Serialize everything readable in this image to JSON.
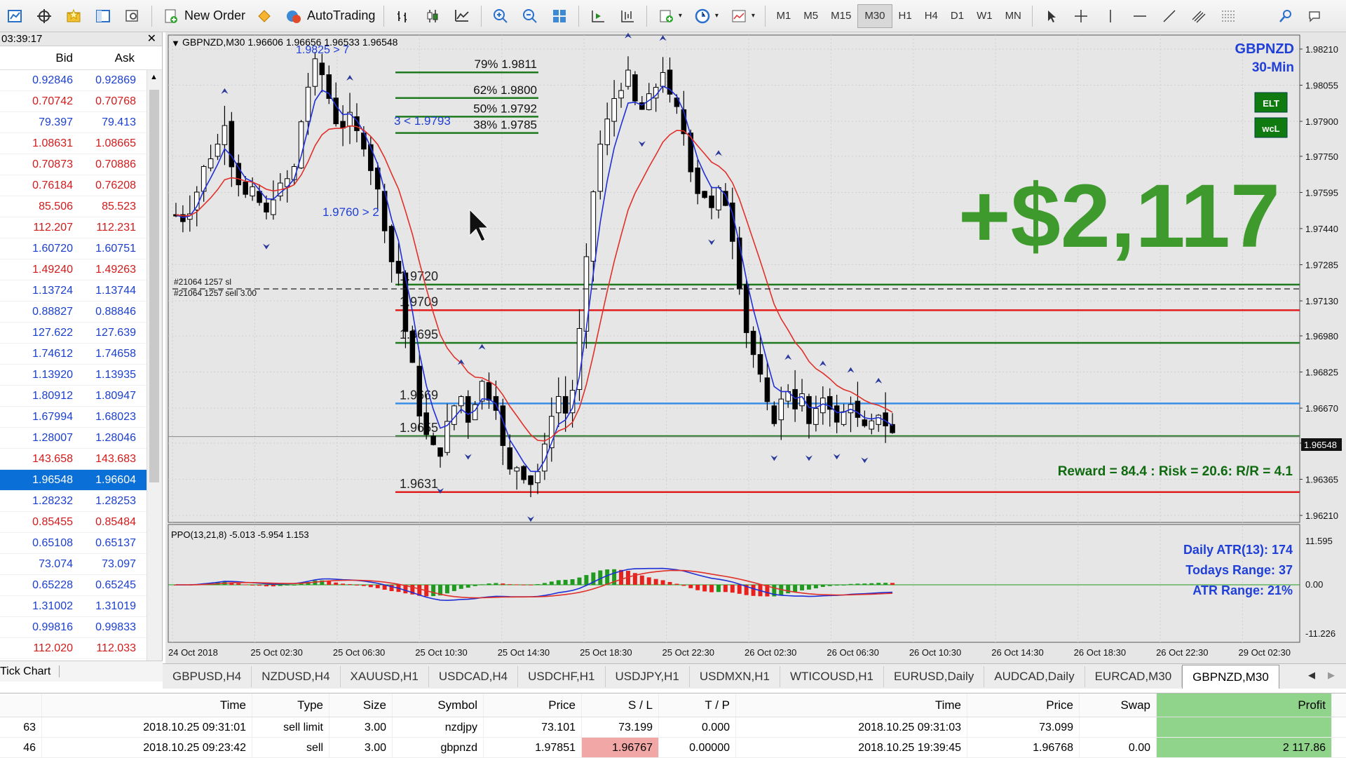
{
  "toolbar": {
    "new_order_label": "New Order",
    "autotrading_label": "AutoTrading",
    "timeframes": [
      "M1",
      "M5",
      "M15",
      "M30",
      "H1",
      "H4",
      "D1",
      "W1",
      "MN"
    ],
    "active_timeframe": "M30"
  },
  "market_watch": {
    "time": "03:39:17",
    "col_bid": "Bid",
    "col_ask": "Ask",
    "rows": [
      {
        "bid": "0.92846",
        "ask": "0.92869",
        "color": "blue"
      },
      {
        "bid": "0.70742",
        "ask": "0.70768",
        "color": "red"
      },
      {
        "bid": "79.397",
        "ask": "79.413",
        "color": "blue"
      },
      {
        "bid": "1.08631",
        "ask": "1.08665",
        "color": "red"
      },
      {
        "bid": "0.70873",
        "ask": "0.70886",
        "color": "red"
      },
      {
        "bid": "0.76184",
        "ask": "0.76208",
        "color": "red"
      },
      {
        "bid": "85.506",
        "ask": "85.523",
        "color": "red"
      },
      {
        "bid": "112.207",
        "ask": "112.231",
        "color": "red"
      },
      {
        "bid": "1.60720",
        "ask": "1.60751",
        "color": "blue"
      },
      {
        "bid": "1.49240",
        "ask": "1.49263",
        "color": "red"
      },
      {
        "bid": "1.13724",
        "ask": "1.13744",
        "color": "blue"
      },
      {
        "bid": "0.88827",
        "ask": "0.88846",
        "color": "blue"
      },
      {
        "bid": "127.622",
        "ask": "127.639",
        "color": "blue"
      },
      {
        "bid": "1.74612",
        "ask": "1.74658",
        "color": "blue"
      },
      {
        "bid": "1.13920",
        "ask": "1.13935",
        "color": "blue"
      },
      {
        "bid": "1.80912",
        "ask": "1.80947",
        "color": "blue"
      },
      {
        "bid": "1.67994",
        "ask": "1.68023",
        "color": "blue"
      },
      {
        "bid": "1.28007",
        "ask": "1.28046",
        "color": "blue"
      },
      {
        "bid": "143.658",
        "ask": "143.683",
        "color": "red"
      },
      {
        "bid": "1.96548",
        "ask": "1.96604",
        "color": "selected"
      },
      {
        "bid": "1.28232",
        "ask": "1.28253",
        "color": "blue"
      },
      {
        "bid": "0.85455",
        "ask": "0.85484",
        "color": "red"
      },
      {
        "bid": "0.65108",
        "ask": "0.65137",
        "color": "blue"
      },
      {
        "bid": "73.074",
        "ask": "73.097",
        "color": "blue"
      },
      {
        "bid": "0.65228",
        "ask": "0.65245",
        "color": "blue"
      },
      {
        "bid": "1.31002",
        "ask": "1.31019",
        "color": "blue"
      },
      {
        "bid": "0.99816",
        "ask": "0.99833",
        "color": "blue"
      },
      {
        "bid": "112.020",
        "ask": "112.033",
        "color": "red"
      }
    ],
    "footer_tab": "Tick Chart"
  },
  "chart": {
    "header": "GBPNZD,M30  1.96606 1.96656 1.96533 1.96548",
    "symbol": "GBPNZD",
    "timeframe": "30-Min",
    "badge1": "ELT",
    "badge2": "wcL",
    "profit_overlay": "+$2,117",
    "reward_risk": "Reward = 84.4 : Risk = 20.6: R/R = 4.1",
    "current_price": "1.96548",
    "fib_labels": [
      "79% 1.9811",
      "62% 1.9800",
      "50% 1.9792",
      "38% 1.9785"
    ],
    "blue_labels": [
      "1.9825 > 7",
      "3 < 1.9793",
      "1.9760 > 2"
    ],
    "order_labels": [
      "#21064 1257 sl",
      "#21064 1257 sell 3.00"
    ],
    "hlines": [
      {
        "price": "1.9720",
        "color": "#1e7a1e"
      },
      {
        "price": "1.9709",
        "color": "#e01e1e"
      },
      {
        "price": "1.9695",
        "color": "#1e7a1e"
      },
      {
        "price": "1.9669",
        "color": "#3a8ee6"
      },
      {
        "price": "1.9655",
        "color": "#1e7a1e"
      },
      {
        "price": "1.9631",
        "color": "#e01e1e"
      }
    ],
    "price_axis": [
      "1.98210",
      "1.98055",
      "1.97900",
      "1.97750",
      "1.97595",
      "1.97440",
      "1.97285",
      "1.97130",
      "1.96980",
      "1.96825",
      "1.96670",
      "1.96520",
      "1.96365",
      "1.96210"
    ],
    "time_axis": [
      "24 Oct 2018",
      "25 Oct 02:30",
      "25 Oct 06:30",
      "25 Oct 10:30",
      "25 Oct 14:30",
      "25 Oct 18:30",
      "25 Oct 22:30",
      "26 Oct 02:30",
      "26 Oct 06:30",
      "26 Oct 10:30",
      "26 Oct 14:30",
      "26 Oct 18:30",
      "26 Oct 22:30",
      "29 Oct 02:30"
    ],
    "indicator": {
      "header": "PPO(13,21,8) -5.013 -5.954 1.153",
      "axis": [
        "11.595",
        "0.00",
        "-11.226"
      ],
      "atr_line1": "Daily ATR(13): 174",
      "atr_line2": "Todays Range: 37",
      "atr_line3": "ATR Range: 21%"
    }
  },
  "chart_tabs": [
    "GBPUSD,H4",
    "NZDUSD,H4",
    "XAUUSD,H1",
    "USDCAD,H4",
    "USDCHF,H1",
    "USDJPY,H1",
    "USDMXN,H1",
    "WTICOUSD,H1",
    "EURUSD,Daily",
    "AUDCAD,Daily",
    "EURCAD,M30",
    "GBPNZD,M30"
  ],
  "active_chart_tab": "GBPNZD,M30",
  "terminal": {
    "columns": [
      "Time",
      "Type",
      "Size",
      "Symbol",
      "Price",
      "S / L",
      "T / P",
      "Time",
      "Price",
      "Swap",
      "Profit"
    ],
    "rows": [
      {
        "id": "63",
        "time": "2018.10.25 09:31:01",
        "type": "sell limit",
        "size": "3.00",
        "symbol": "nzdjpy",
        "price": "73.101",
        "sl": "73.199",
        "tp": "0.000",
        "time2": "2018.10.25 09:31:03",
        "price2": "73.099",
        "swap": "",
        "profit": ""
      },
      {
        "id": "46",
        "time": "2018.10.25 09:23:42",
        "type": "sell",
        "size": "3.00",
        "symbol": "gbpnzd",
        "price": "1.97851",
        "sl": "1.96767",
        "tp": "0.00000",
        "time2": "2018.10.25 19:39:45",
        "price2": "1.96768",
        "swap": "0.00",
        "profit": "2 117.86"
      }
    ]
  },
  "colors": {
    "bull_candle": "#ffffff",
    "bear_candle": "#000000",
    "ma_fast": "#1f2fd6",
    "ma_slow": "#e0302a",
    "profit_green": "#3f9a2e",
    "hist_green": "#1f9a1f",
    "hist_red": "#e8211d"
  }
}
